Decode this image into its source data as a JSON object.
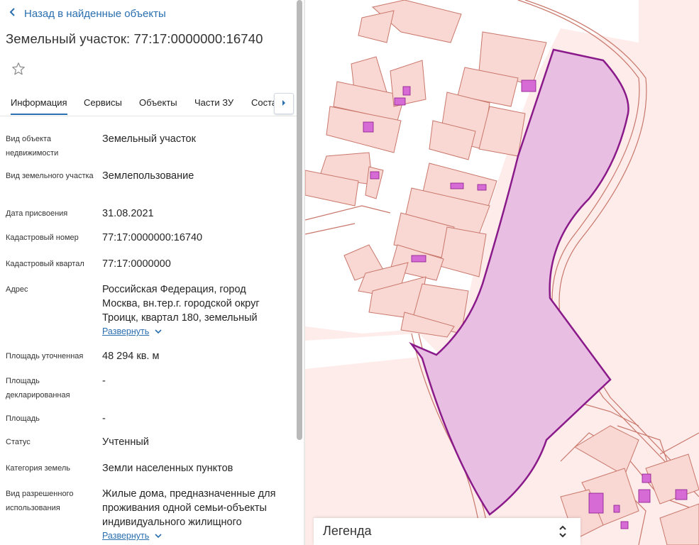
{
  "nav": {
    "back_label": "Назад в найденные объекты"
  },
  "object": {
    "title": "Земельный участок: 77:17:0000000:16740"
  },
  "tabs": [
    {
      "label": "Информация",
      "active": true
    },
    {
      "label": "Сервисы",
      "active": false
    },
    {
      "label": "Объекты",
      "active": false
    },
    {
      "label": "Части ЗУ",
      "active": false
    },
    {
      "label": "Соста",
      "active": false
    }
  ],
  "fields": {
    "type": {
      "label": "Вид объекта недвижимости",
      "value": "Земельный участок"
    },
    "plot_kind": {
      "label": "Вид земельного участка",
      "value": "Землепользование"
    },
    "assign_date": {
      "label": "Дата присвоения",
      "value": "31.08.2021"
    },
    "cad_number": {
      "label": "Кадастровый номер",
      "value": "77:17:0000000:16740"
    },
    "cad_quarter": {
      "label": "Кадастровый квартал",
      "value": "77:17:0000000"
    },
    "address": {
      "label": "Адрес",
      "value": "Российская Федерация, город Москва, вн.тер.г. городской округ Троицк, квартал 180, земельный",
      "expand": "Развернуть"
    },
    "area_precise": {
      "label": "Площадь уточненная",
      "value": "48 294 кв. м"
    },
    "area_decl": {
      "label": "Площадь декларированная",
      "value": "-"
    },
    "area": {
      "label": "Площадь",
      "value": "-"
    },
    "status": {
      "label": "Статус",
      "value": "Учтенный"
    },
    "category": {
      "label": "Категория земель",
      "value": "Земли населенных пунктов"
    },
    "permitted": {
      "label": "Вид разрешенного использования",
      "value": "Жилые дома, предназначенные для проживания одной семьи-объекты индивидуального жилищного",
      "expand": "Развернуть"
    }
  },
  "map": {
    "legend_title": "Легенда",
    "colors": {
      "background": "#fdecea",
      "parcel_fill": "#e8bfe3",
      "parcel_stroke": "#8a1a8a",
      "boundary": "#c9776b",
      "building": "#d76bd6"
    }
  },
  "icons": {
    "back": "chevron-left-icon",
    "favorite": "star-outline-icon",
    "tab_scroll": "chevron-right-icon",
    "expand": "chevron-down-icon",
    "legend_toggle": "updown-chevron-icon"
  }
}
